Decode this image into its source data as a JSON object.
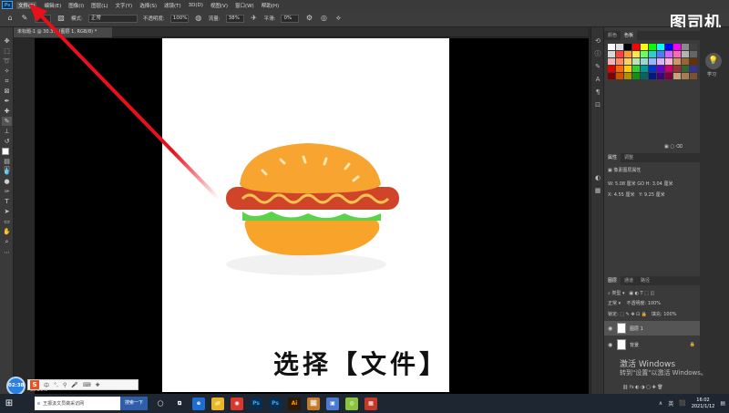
{
  "menu": {
    "items": [
      "文件(F)",
      "编辑(E)",
      "图像(I)",
      "图层(L)",
      "文字(Y)",
      "选择(S)",
      "滤镜(T)",
      "3D(D)",
      "视图(V)",
      "窗口(W)",
      "帮助(H)"
    ],
    "logo": "Ps"
  },
  "options": {
    "mode_label": "模式:",
    "mode_value": "正常",
    "opacity_label": "不透明度:",
    "opacity_value": "100%",
    "flow_label": "流量:",
    "flow_value": "38%",
    "smooth_label": "平滑:",
    "smooth_value": "0%"
  },
  "watermark": "图司机",
  "document": {
    "tab_label": "未标题-1 @ 30.3% (图层 1, RGB/8) *",
    "zoom": "30.29%"
  },
  "caption": "选择【文件】",
  "panels": {
    "top_tabs": [
      "颜色",
      "色板"
    ],
    "learn_label": "学习",
    "props_tabs": [
      "属性",
      "调整"
    ],
    "props_title": "像素图层属性",
    "w_label": "W:",
    "w_value": "5.08 厘米",
    "h_label": "H:",
    "h_value": "3.04 厘米",
    "x_label": "X:",
    "x_value": "4.55 厘米",
    "y_label": "Y:",
    "y_value": "9.25 厘米",
    "go_label": "GO",
    "layers_tabs": [
      "图层",
      "通道",
      "路径"
    ],
    "filter_label": "类型",
    "blend_value": "正常",
    "opacity_label": "不透明度:",
    "opacity_value": "100%",
    "lock_label": "锁定:",
    "fill_label": "填充:",
    "fill_value": "100%",
    "layers": [
      {
        "name": "图层 1"
      },
      {
        "name": "背景"
      }
    ],
    "swatch_colors": [
      "#ffffff",
      "#e0e0e0",
      "#000000",
      "#ff0000",
      "#ffff00",
      "#00ff00",
      "#00ffff",
      "#0000ff",
      "#ff00ff",
      "#8a8a8a",
      "#404040",
      "#d9d9d9",
      "#ff4040",
      "#ff9933",
      "#ffe64d",
      "#66ff66",
      "#33cccc",
      "#4d79ff",
      "#cc66ff",
      "#ff66b3",
      "#b3b3b3",
      "#666666",
      "#f2b3b3",
      "#ff8c66",
      "#ffcc66",
      "#b3e6b3",
      "#99d6d6",
      "#99b3ff",
      "#d9b3ff",
      "#ffb3d9",
      "#cc9966",
      "#996633",
      "#663300",
      "#e60000",
      "#ff6600",
      "#ffcc00",
      "#33cc33",
      "#009999",
      "#0033cc",
      "#6600cc",
      "#cc0066",
      "#993333",
      "#336633",
      "#333399",
      "#800000",
      "#cc5200",
      "#b38f00",
      "#1a8c1a",
      "#006666",
      "#001a80",
      "#400080",
      "#80003f",
      "#c8a27a",
      "#a67c52",
      "#7a5230"
    ]
  },
  "activate_windows": {
    "title": "激活 Windows",
    "subtitle": "转到\"设置\"以激活 Windows。"
  },
  "recorder": {
    "time": "02:38"
  },
  "ime": {
    "logo": "S",
    "items": [
      "中",
      "°,",
      "⚲",
      "🎤",
      "⌨",
      "✚"
    ]
  },
  "taskbar": {
    "search_placeholder": "王振汲文员做采访网",
    "search_button": "搜索一下",
    "apps": [
      "◯",
      "⧉",
      "e",
      "📁",
      "◉",
      "Ps",
      "Ps",
      "Ai",
      "🖼",
      "▣",
      "◎",
      "▦"
    ],
    "ime_label": "英",
    "time": "16:02",
    "date": "2021/1/12"
  }
}
